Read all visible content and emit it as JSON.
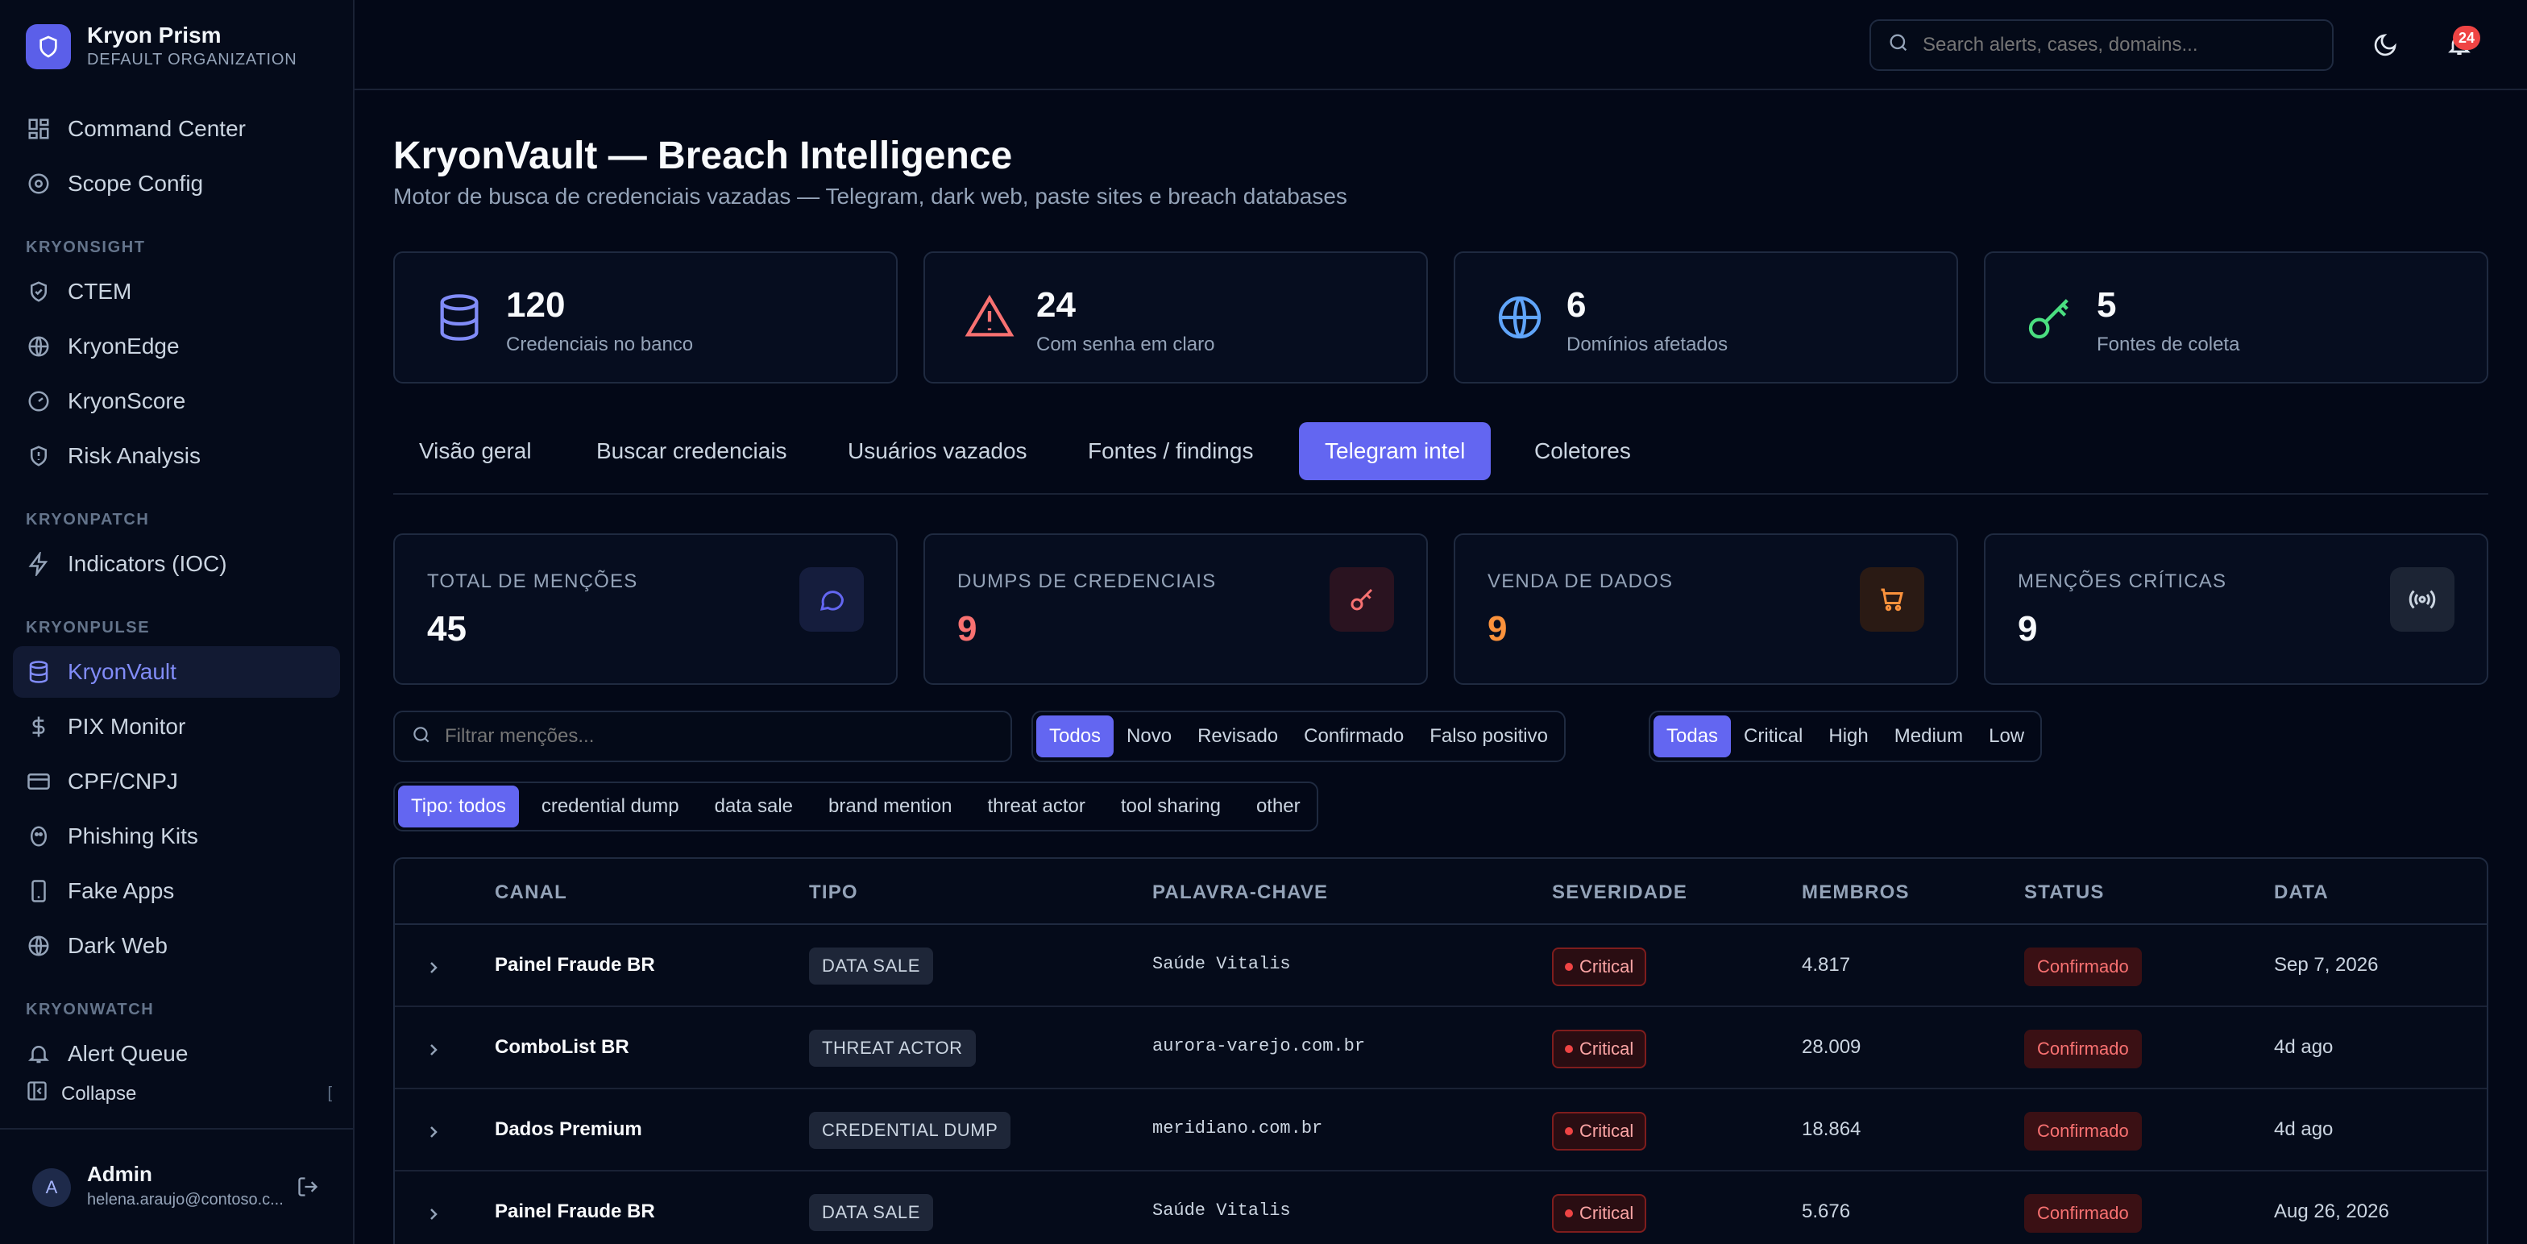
{
  "brand": {
    "name": "Kryon Prism",
    "org": "DEFAULT ORGANIZATION"
  },
  "sidebar": {
    "top_items": [
      {
        "label": "Command Center",
        "icon": "grid-icon"
      },
      {
        "label": "Scope Config",
        "icon": "target-icon"
      }
    ],
    "sections": [
      {
        "title": "KRYONSIGHT",
        "items": [
          {
            "label": "CTEM",
            "icon": "shield-check-icon"
          },
          {
            "label": "KryonEdge",
            "icon": "globe-icon"
          },
          {
            "label": "KryonScore",
            "icon": "gauge-icon"
          },
          {
            "label": "Risk Analysis",
            "icon": "shield-alert-icon"
          }
        ]
      },
      {
        "title": "KRYONPATCH",
        "items": [
          {
            "label": "Indicators (IOC)",
            "icon": "zap-icon"
          }
        ]
      },
      {
        "title": "KRYONPULSE",
        "items": [
          {
            "label": "KryonVault",
            "icon": "database-icon",
            "active": true
          },
          {
            "label": "PIX Monitor",
            "icon": "dollar-icon"
          },
          {
            "label": "CPF/CNPJ",
            "icon": "card-icon"
          },
          {
            "label": "Phishing Kits",
            "icon": "fish-icon"
          },
          {
            "label": "Fake Apps",
            "icon": "phone-icon"
          },
          {
            "label": "Dark Web",
            "icon": "globe-icon"
          }
        ]
      },
      {
        "title": "KRYONWATCH",
        "items": [
          {
            "label": "Alert Queue",
            "icon": "bell-icon"
          }
        ]
      }
    ],
    "collapse_label": "Collapse",
    "collapse_kbd": "[",
    "user": {
      "initial": "A",
      "name": "Admin",
      "email": "helena.araujo@contoso.c..."
    }
  },
  "topbar": {
    "search_placeholder": "Search alerts, cases, domains...",
    "notifications": "24"
  },
  "page": {
    "title": "KryonVault — Breach Intelligence",
    "subtitle": "Motor de busca de credenciais vazadas — Telegram, dark web, paste sites e breach databases"
  },
  "stats": [
    {
      "value": "120",
      "label": "Credenciais no banco",
      "icon": "database-icon",
      "color": "#818cf8"
    },
    {
      "value": "24",
      "label": "Com senha em claro",
      "icon": "alert-triangle-icon",
      "color": "#f87171"
    },
    {
      "value": "6",
      "label": "Domínios afetados",
      "icon": "globe-icon",
      "color": "#60a5fa"
    },
    {
      "value": "5",
      "label": "Fontes de coleta",
      "icon": "key-icon",
      "color": "#4ade80"
    }
  ],
  "tabs": [
    {
      "label": "Visão geral"
    },
    {
      "label": "Buscar credenciais"
    },
    {
      "label": "Usuários vazados"
    },
    {
      "label": "Fontes / findings"
    },
    {
      "label": "Telegram intel",
      "active": true
    },
    {
      "label": "Coletores"
    }
  ],
  "metrics": [
    {
      "label": "TOTAL DE MENÇÕES",
      "value": "45",
      "color": "#f8fafc",
      "icon": "message-icon",
      "icon_color": "#6366f1",
      "icon_bg": "#151d3d"
    },
    {
      "label": "DUMPS DE CREDENCIAIS",
      "value": "9",
      "color": "#f87171",
      "icon": "key-icon",
      "icon_color": "#f87171",
      "icon_bg": "#2a1320"
    },
    {
      "label": "VENDA DE DADOS",
      "value": "9",
      "color": "#fb923c",
      "icon": "cart-icon",
      "icon_color": "#fb923c",
      "icon_bg": "#2a1a14"
    },
    {
      "label": "MENÇÕES CRÍTICAS",
      "value": "9",
      "color": "#f8fafc",
      "icon": "radio-icon",
      "icon_color": "#cbd5e1",
      "icon_bg": "#1c2434"
    }
  ],
  "filters": {
    "search_placeholder": "Filtrar menções...",
    "status": [
      "Todos",
      "Novo",
      "Revisado",
      "Confirmado",
      "Falso positivo"
    ],
    "status_selected": "Todos",
    "severity": [
      "Todas",
      "Critical",
      "High",
      "Medium",
      "Low"
    ],
    "severity_selected": "Todas",
    "type": [
      "Tipo: todos",
      "credential dump",
      "data sale",
      "brand mention",
      "threat actor",
      "tool sharing",
      "other"
    ],
    "type_selected": "Tipo: todos"
  },
  "table": {
    "columns": [
      "CANAL",
      "TIPO",
      "PALAVRA-CHAVE",
      "SEVERIDADE",
      "MEMBROS",
      "STATUS",
      "DATA"
    ],
    "rows": [
      {
        "canal": "Painel Fraude BR",
        "tipo": "DATA SALE",
        "keyword": "Saúde Vitalis",
        "severity": "Critical",
        "members": "4.817",
        "status": "Confirmado",
        "date": "Sep 7, 2026"
      },
      {
        "canal": "ComboList BR",
        "tipo": "THREAT ACTOR",
        "keyword": "aurora-varejo.com.br",
        "severity": "Critical",
        "members": "28.009",
        "status": "Confirmado",
        "date": "4d ago"
      },
      {
        "canal": "Dados Premium",
        "tipo": "CREDENTIAL DUMP",
        "keyword": "meridiano.com.br",
        "severity": "Critical",
        "members": "18.864",
        "status": "Confirmado",
        "date": "4d ago"
      },
      {
        "canal": "Painel Fraude BR",
        "tipo": "DATA SALE",
        "keyword": "Saúde Vitalis",
        "severity": "Critical",
        "members": "5.676",
        "status": "Confirmado",
        "date": "Aug 26, 2026"
      }
    ]
  }
}
